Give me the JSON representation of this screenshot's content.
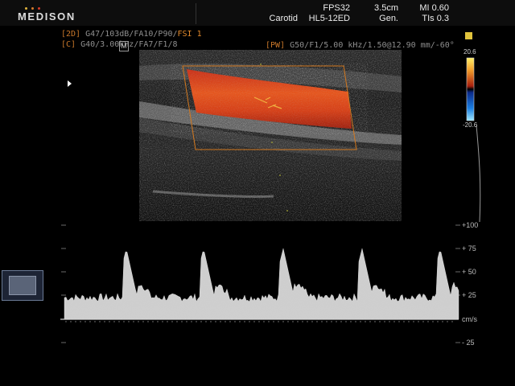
{
  "header": {
    "brand": "MEDISON",
    "brand_dot_colors": [
      "#e0b43c",
      "#d77a2a",
      "#d43c2a"
    ],
    "preset": "Carotid",
    "fps": "FPS32",
    "probe": "HL5-12ED",
    "depth": "3.5cm",
    "frequency_mode": "Gen.",
    "mi": "MI 0.60",
    "tis": "TIs 0.3"
  },
  "params": {
    "mode_2d_tag": "[2D]",
    "mode_2d": " G47/103dB/FA10/P90/",
    "fsi": "FSI 1",
    "mode_c_tag": "[C]",
    "mode_c": " G40/3.00kHz/FA7/F1/8",
    "m_marker": "M",
    "mode_pw_tag": "[PW]",
    "mode_pw": " G50/F1/5.00 kHz/1.50@12.90 mm/-60°"
  },
  "color_scale": {
    "max_label": "20.6",
    "min_label": "-20.6"
  },
  "doppler": {
    "unit": "cm/s",
    "axis_labels": [
      "+100",
      "+ 75",
      "+ 50",
      "+ 25",
      "- 25"
    ],
    "axis_values": [
      100,
      75,
      50,
      25,
      -25
    ]
  }
}
